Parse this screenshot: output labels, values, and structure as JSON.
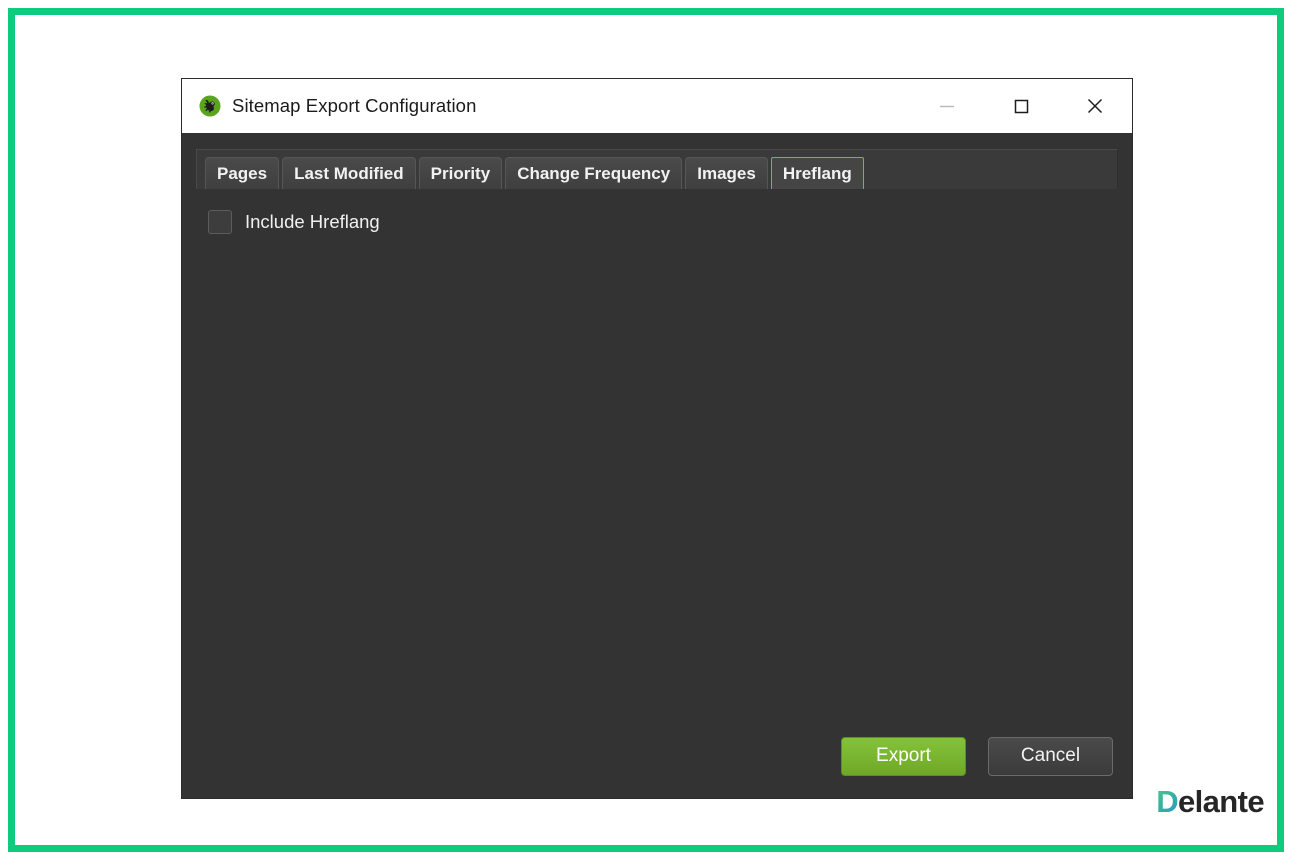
{
  "frame": {
    "accent_color": "#0ecb7e",
    "background": "#ffffff"
  },
  "window": {
    "title": "Sitemap Export Configuration",
    "app_icon": "screaming-frog-icon",
    "background": "#333333",
    "titlebar_background": "#ffffff",
    "controls": [
      {
        "name": "minimize",
        "glyph": "minimize-icon"
      },
      {
        "name": "maximize",
        "glyph": "maximize-icon"
      },
      {
        "name": "close",
        "glyph": "close-icon"
      }
    ]
  },
  "tabs": {
    "active_index": 5,
    "active_border_color": "#6ec02a",
    "items": [
      {
        "label": "Pages"
      },
      {
        "label": "Last Modified"
      },
      {
        "label": "Priority"
      },
      {
        "label": "Change Frequency"
      },
      {
        "label": "Images"
      },
      {
        "label": "Hreflang"
      }
    ]
  },
  "content": {
    "checkbox": {
      "label": "Include Hreflang",
      "checked": false
    }
  },
  "footer": {
    "export_label": "Export",
    "export_color": "#7ab530",
    "cancel_label": "Cancel"
  },
  "logo": {
    "first_letter": "D",
    "rest": "elante"
  }
}
